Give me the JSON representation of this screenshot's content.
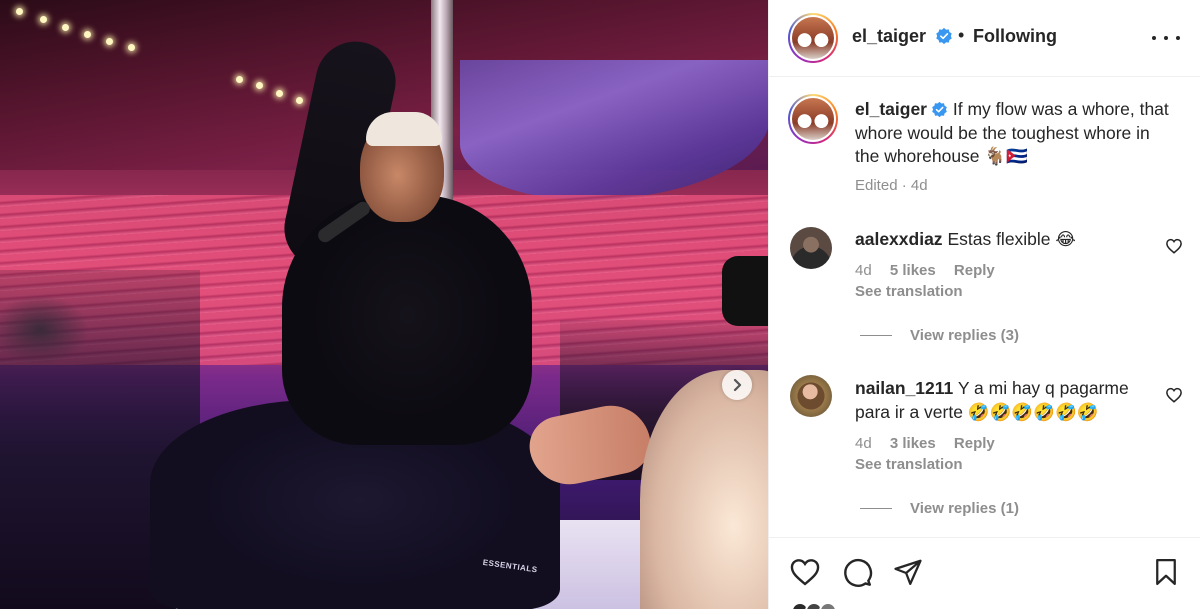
{
  "post": {
    "next_arrow_icon": "chevron-right-icon",
    "print_text": "ESSENTIALS"
  },
  "header": {
    "username": "el_taiger",
    "verified_icon": "verified-badge-icon",
    "separator": "•",
    "follow_status": "Following",
    "more_icon": "more-options-icon"
  },
  "caption": {
    "username": "el_taiger",
    "text": "If my flow was a whore, that whore would be the toughest whore in the whorehouse 🐐🇨🇺",
    "meta": "Edited · 4d"
  },
  "comments": [
    {
      "username": "aalexxdiaz",
      "text": "Estas flexible 😂",
      "time": "4d",
      "likes": "5 likes",
      "reply": "Reply",
      "translate": "See translation",
      "replies": "View replies (3)"
    },
    {
      "username": "nailan_1211",
      "text": "Y a mi hay q pagarme para ir a verte 🤣🤣🤣🤣🤣🤣",
      "time": "4d",
      "likes": "3 likes",
      "reply": "Reply",
      "translate": "See translation",
      "replies": "View replies (1)"
    }
  ],
  "actions": {
    "like_icon": "heart-icon",
    "comment_icon": "comment-icon",
    "share_icon": "share-icon",
    "save_icon": "bookmark-icon"
  },
  "colors": {
    "text": "#262626",
    "secondary": "#8e8e8e",
    "verified": "#3897f0",
    "divider": "#efefef"
  }
}
